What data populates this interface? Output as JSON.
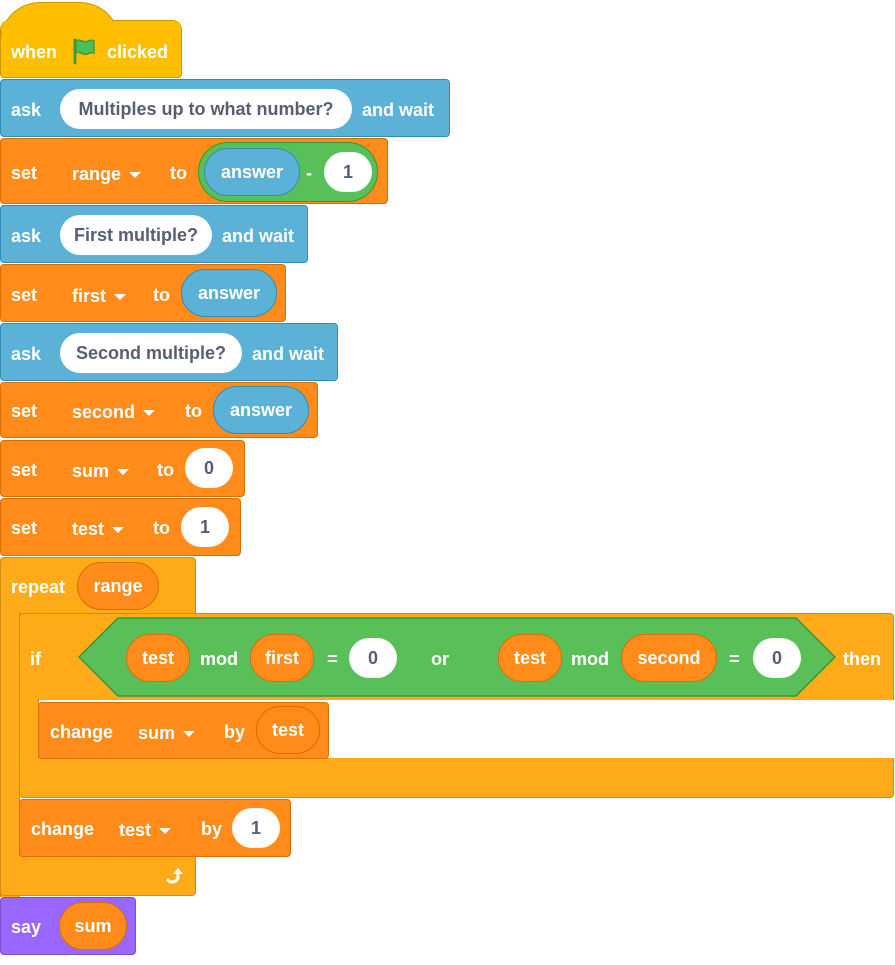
{
  "hat": {
    "when": "when",
    "clicked": "clicked",
    "flag_color": "#4cbf56"
  },
  "ask1": {
    "label": "ask",
    "question": "Multiples up to what number?",
    "wait": "and wait"
  },
  "set_range": {
    "label": "set",
    "var": "range",
    "to": "to",
    "reporter": "answer",
    "op": "-",
    "value": "1"
  },
  "ask2": {
    "label": "ask",
    "question": "First multiple?",
    "wait": "and wait"
  },
  "set_first": {
    "label": "set",
    "var": "first",
    "to": "to",
    "reporter": "answer"
  },
  "ask3": {
    "label": "ask",
    "question": "Second multiple?",
    "wait": "and wait"
  },
  "set_second": {
    "label": "set",
    "var": "second",
    "to": "to",
    "reporter": "answer"
  },
  "set_sum": {
    "label": "set",
    "var": "sum",
    "to": "to",
    "value": "0"
  },
  "set_test": {
    "label": "set",
    "var": "test",
    "to": "to",
    "value": "1"
  },
  "repeat": {
    "label": "repeat",
    "count": "range"
  },
  "if": {
    "label": "if",
    "then": "then",
    "left": {
      "a": "test",
      "mod": "mod",
      "b": "first",
      "eq": "=",
      "value": "0"
    },
    "or": "or",
    "right": {
      "a": "test",
      "mod": "mod",
      "b": "second",
      "eq": "=",
      "value": "0"
    }
  },
  "change_sum": {
    "label": "change",
    "var": "sum",
    "by": "by",
    "value": "test"
  },
  "change_test": {
    "label": "change",
    "var": "test",
    "by": "by",
    "value": "1"
  },
  "say": {
    "label": "say",
    "value": "sum"
  },
  "colors": {
    "events": "#ffbf00",
    "sensing": "#5cb1d6",
    "variables": "#ff8c1a",
    "control": "#ffab19",
    "operators": "#59c059",
    "looks": "#9966ff"
  }
}
